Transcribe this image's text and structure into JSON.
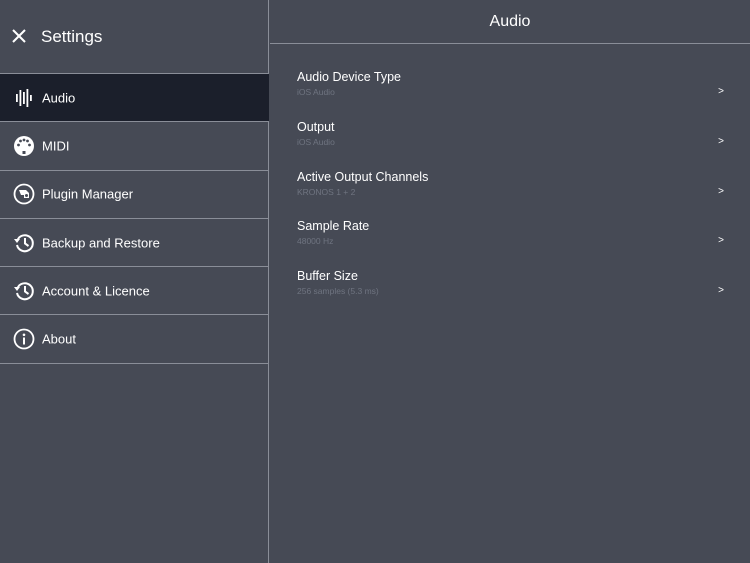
{
  "sidebar": {
    "title": "Settings",
    "items": [
      {
        "label": "Audio",
        "icon": "waveform-icon",
        "active": true
      },
      {
        "label": "MIDI",
        "icon": "midi-connector-icon",
        "active": false
      },
      {
        "label": "Plugin Manager",
        "icon": "plugin-icon",
        "active": false
      },
      {
        "label": "Backup and Restore",
        "icon": "history-icon",
        "active": false
      },
      {
        "label": "Account & Licence",
        "icon": "history-icon",
        "active": false
      },
      {
        "label": "About",
        "icon": "info-icon",
        "active": false
      }
    ]
  },
  "main": {
    "title": "Audio",
    "settings": [
      {
        "title": "Audio Device Type",
        "value": "iOS Audio",
        "chevron": ">"
      },
      {
        "title": "Output",
        "value": "iOS Audio",
        "chevron": ">"
      },
      {
        "title": "Active Output Channels",
        "value": "KRONOS 1 + 2",
        "chevron": ">"
      },
      {
        "title": "Sample Rate",
        "value": "48000 Hz",
        "chevron": ">"
      },
      {
        "title": "Buffer Size",
        "value": "256 samples (5.3 ms)",
        "chevron": ">"
      }
    ]
  },
  "colors": {
    "background": "#464a55",
    "active_item": "#1b1f2b",
    "divider": "#8a8e98",
    "secondary_text": "#6f7480"
  }
}
